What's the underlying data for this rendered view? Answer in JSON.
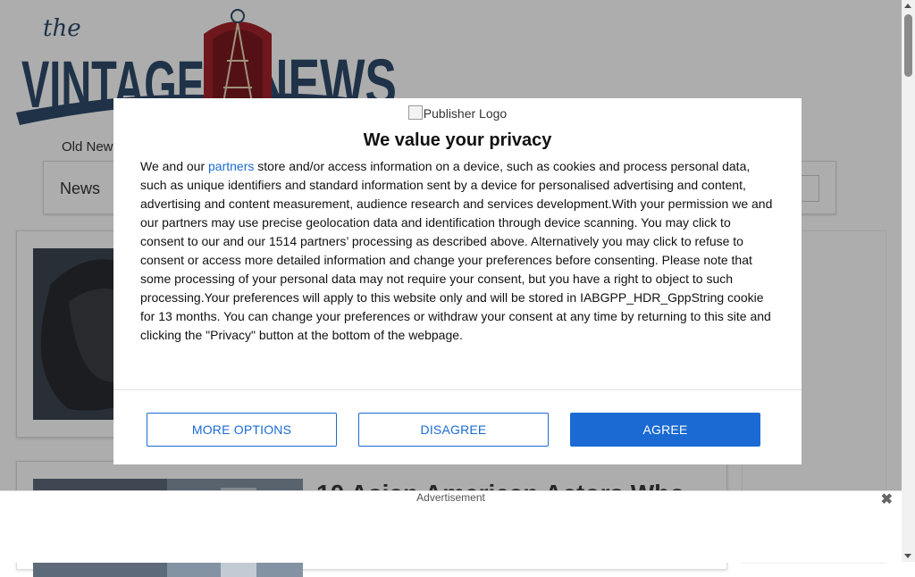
{
  "site": {
    "logo_text_top": "the",
    "logo_text_left": "VINTAGE",
    "logo_text_right": "NEWS",
    "top_link": "Old New",
    "nav_item": "News"
  },
  "articles": [
    {
      "title": ""
    },
    {
      "title": "10 Asian American Actors Who"
    }
  ],
  "consent": {
    "publisher_logo_alt": "Publisher Logo",
    "title": "We value your privacy",
    "body_prefix": "We and our ",
    "partners_link": "partners",
    "body_text": " store and/or access information on a device, such as cookies and process personal data, such as unique identifiers and standard information sent by a device for personalised advertising and content, advertising and content measurement, audience research and services development.With your permission we and our partners may use precise geolocation data and identification through device scanning. You may click to consent to our and our 1514 partners’ processing as described above. Alternatively you may click to refuse to consent or access more detailed information and change your preferences before consenting. Please note that some processing of your personal data may not require your consent, but you have a right to object to such processing.Your preferences will apply to this website only and will be stored in IABGPP_HDR_GppString cookie for 13 months. You can change your preferences or withdraw your consent at any time by returning to this site and clicking the \"Privacy\" button at the bottom of the webpage.",
    "buttons": {
      "more_options": "MORE OPTIONS",
      "disagree": "DISAGREE",
      "agree": "AGREE"
    }
  },
  "ad": {
    "label": "Advertisement",
    "close_symbol": "✖"
  },
  "colors": {
    "primary": "#1b6ad3",
    "logo_blue": "#2f4a6b",
    "logo_red": "#a3242c"
  }
}
